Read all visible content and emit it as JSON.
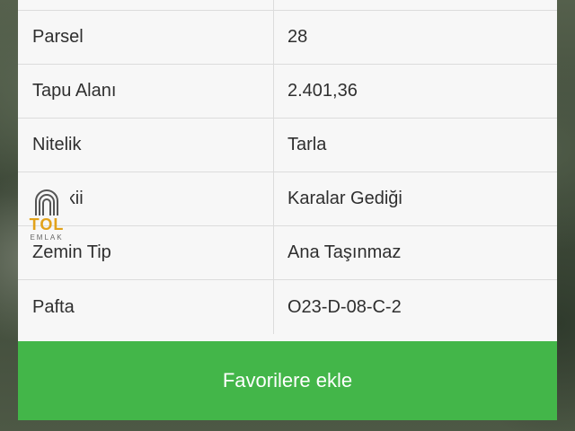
{
  "property_table": {
    "rows": [
      {
        "label": "",
        "value": ""
      },
      {
        "label": "Parsel",
        "value": "28"
      },
      {
        "label": "Tapu Alanı",
        "value": "2.401,36"
      },
      {
        "label": "Nitelik",
        "value": "Tarla"
      },
      {
        "label": "Mevkii",
        "value": "Karalar Gediği"
      },
      {
        "label": "Zemin Tip",
        "value": "Ana Taşınmaz"
      },
      {
        "label": "Pafta",
        "value": "O23-D-08-C-2"
      }
    ]
  },
  "watermark": {
    "brand": "TOL",
    "sub": "EMLAK"
  },
  "favorite_button": {
    "label": "Favorilere ekle",
    "color": "#43b649"
  }
}
